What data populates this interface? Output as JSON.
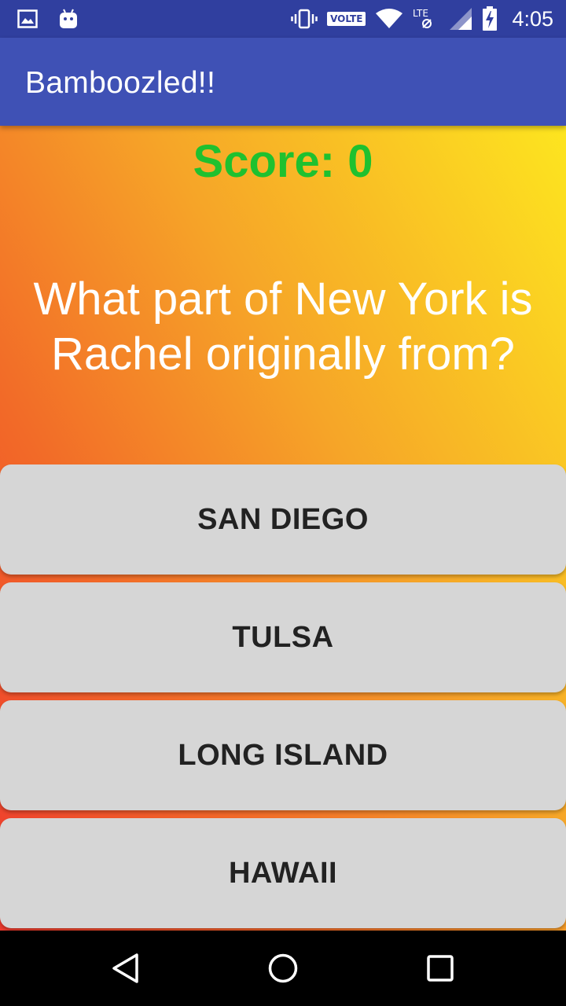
{
  "status_bar": {
    "left_icons": [
      "image-icon",
      "android-icon"
    ],
    "right_icons": [
      "vibrate-icon",
      "volte-badge",
      "wifi-icon",
      "lte-icon",
      "signal-icon",
      "battery-charging-icon"
    ],
    "volte_label": "VOLTE",
    "time": "4:05",
    "color": "#303F9F"
  },
  "app_bar": {
    "title": "Bamboozled!!",
    "color": "#3F51B5"
  },
  "quiz": {
    "score_label": "Score: ",
    "score_value": "0",
    "score_color": "#1fc12f",
    "question": "What part of New York is Rachel originally from?",
    "answers": [
      {
        "label": "SAN DIEGO"
      },
      {
        "label": "TULSA"
      },
      {
        "label": "LONG ISLAND"
      },
      {
        "label": "HAWAII"
      }
    ]
  },
  "nav_bar": {
    "buttons": [
      "back-icon",
      "home-icon",
      "recents-icon"
    ]
  }
}
